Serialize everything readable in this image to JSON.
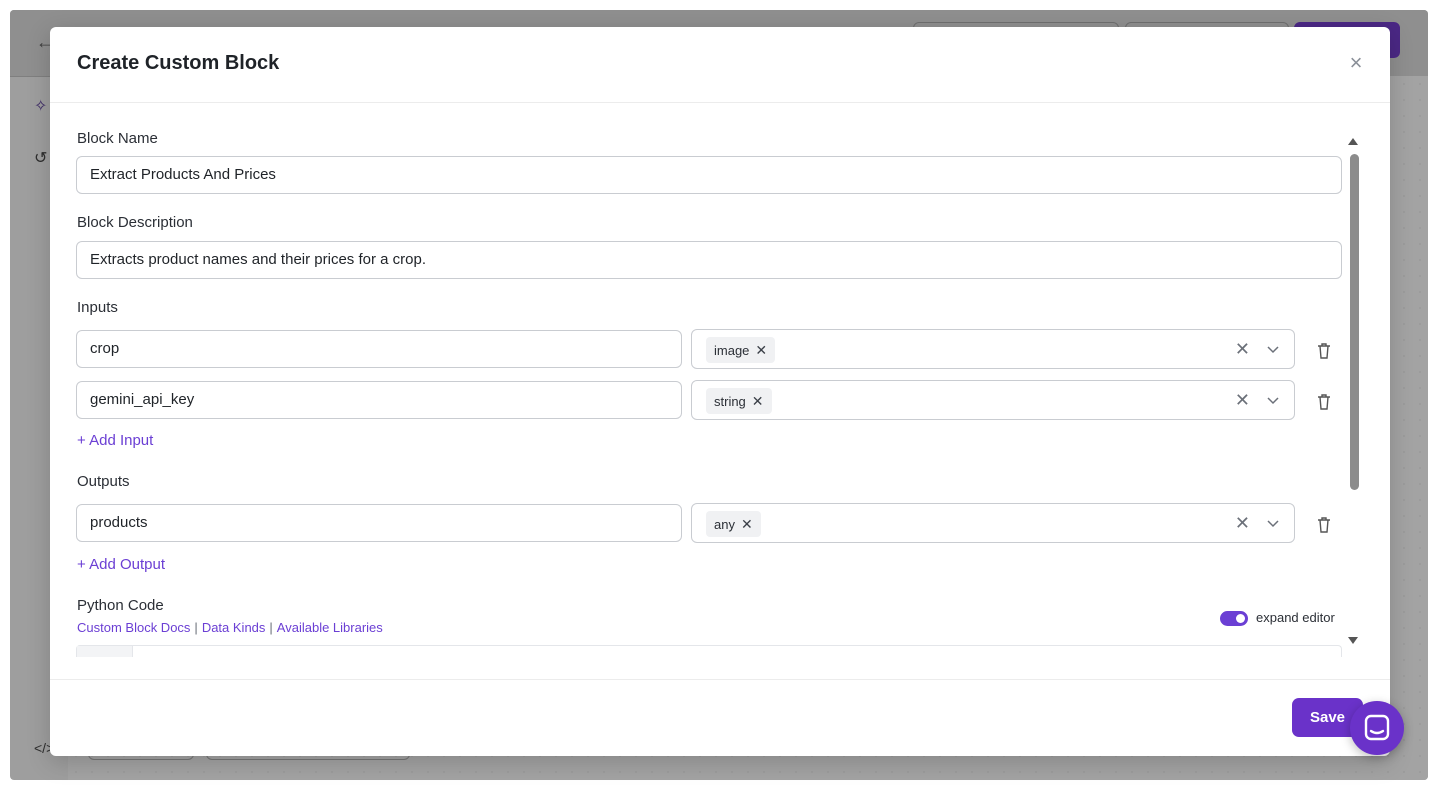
{
  "modal": {
    "title": "Create Custom Block",
    "block_name": {
      "label": "Block Name",
      "value": "Extract Products And Prices"
    },
    "block_description": {
      "label": "Block Description",
      "value": "Extracts product names and their prices for a crop."
    },
    "inputs": {
      "label": "Inputs",
      "items": [
        {
          "name": "crop",
          "type": "image"
        },
        {
          "name": "gemini_api_key",
          "type": "string"
        }
      ],
      "add_label": "+ Add Input"
    },
    "outputs": {
      "label": "Outputs",
      "items": [
        {
          "name": "products",
          "type": "any"
        }
      ],
      "add_label": "+ Add Output"
    },
    "python_code": {
      "label": "Python Code",
      "links": [
        "Custom Block Docs",
        "Data Kinds",
        "Available Libraries"
      ],
      "expand_editor": {
        "label": "expand editor",
        "on": true
      }
    },
    "save_label": "Save"
  },
  "colors": {
    "accent": "#6a32c9",
    "link": "#6b3fd4"
  }
}
